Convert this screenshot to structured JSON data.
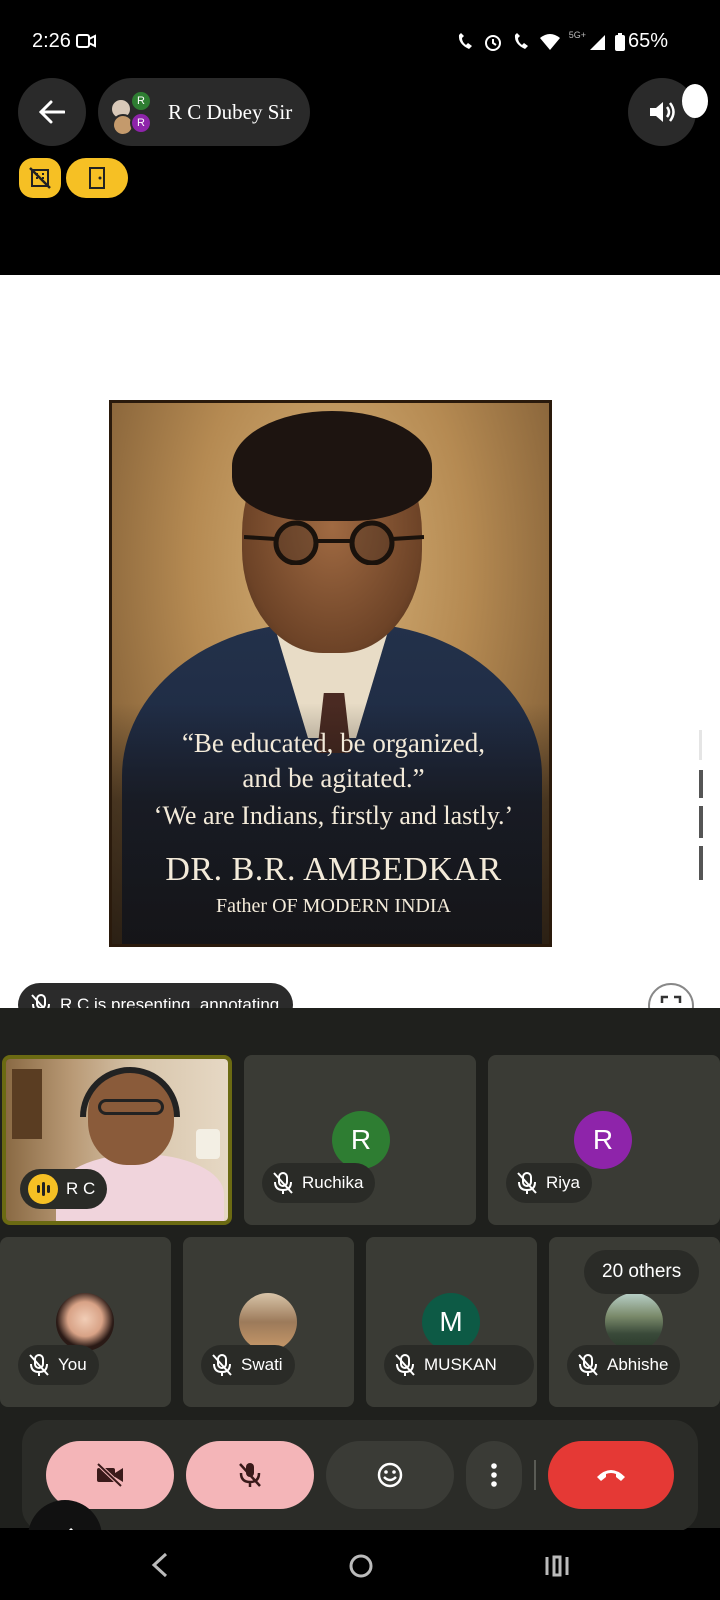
{
  "status_bar": {
    "time": "2:26",
    "battery": "65%",
    "network": "5G+"
  },
  "header": {
    "title": "R C Dubey Sir",
    "avatar_letters": [
      "R",
      "R"
    ]
  },
  "presentation": {
    "quote_line1": "“Be educated, be organized,",
    "quote_line2": "and be agitated.”",
    "quote_line3": "‘We are Indians, firstly and lastly.’",
    "name": "DR. B.R. AMBEDKAR",
    "subtitle": "Father OF MODERN INDIA"
  },
  "presenting_status": "R C is presenting, annotating",
  "participants": [
    {
      "name": "R C",
      "type": "video",
      "speaking": true
    },
    {
      "name": "Ruchika",
      "letter": "R",
      "color": "#2e7d32"
    },
    {
      "name": "Riya",
      "letter": "R",
      "color": "#8e24aa"
    },
    {
      "name": "You",
      "type": "photo"
    },
    {
      "name": "Swati",
      "type": "photo"
    },
    {
      "name": "MUSKAN",
      "letter": "M",
      "color": "#0d5a45"
    },
    {
      "name": "Abhishe",
      "type": "photo"
    }
  ],
  "others_count": "20 others",
  "colors": {
    "accent_yellow": "#f6c024",
    "end_call": "#e53935",
    "muted_pink": "#f4b5b8"
  }
}
